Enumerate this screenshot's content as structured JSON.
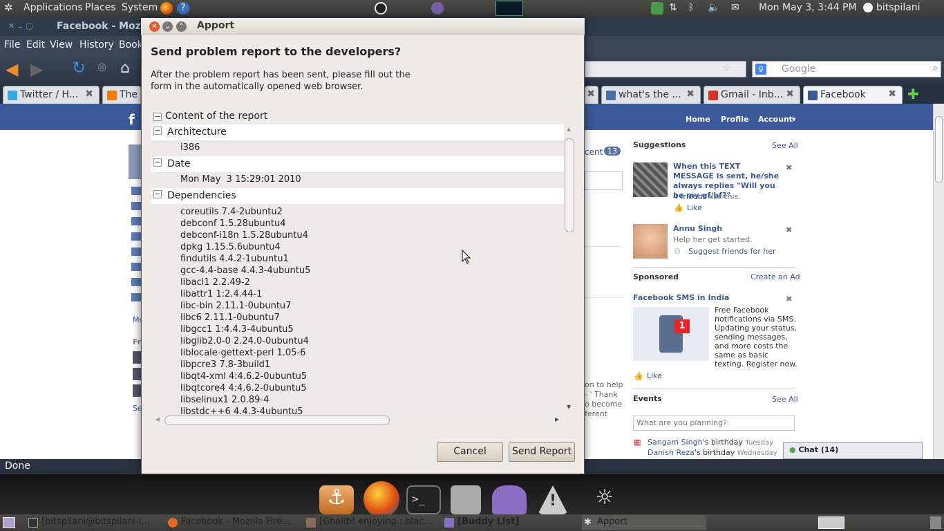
{
  "top_panel": {
    "menus": [
      "Applications",
      "Places",
      "System"
    ],
    "clock": "Mon May  3,  3:44 PM",
    "user": "bitspilani"
  },
  "firefox": {
    "title": "Facebook - Mozi",
    "menu": [
      "File",
      "Edit",
      "View",
      "History",
      "Book"
    ],
    "search_placeholder": "Google",
    "tabs": [
      {
        "label": "Twitter / H...",
        "color": "#33aadd"
      },
      {
        "label": "The S",
        "color": "#f57d00"
      },
      {
        "label": "what's the ...",
        "color": "#4b6ea8"
      },
      {
        "label": "Gmail - Inb...",
        "color": "#d93025"
      },
      {
        "label": "Facebook",
        "color": "#3b5998"
      }
    ],
    "status": "Done"
  },
  "facebook": {
    "nav": [
      "Home",
      "Profile",
      "Account"
    ],
    "recent_label": "cent",
    "recent_count": "13",
    "left_more": "Mo",
    "left_fr": "Fr",
    "left_se": "Se",
    "mid_fragment": [
      "on to help",
      "- ' Thank",
      "o become",
      "ferent"
    ],
    "suggestions": {
      "title": "Suggestions",
      "see_all": "See All",
      "item1_text": "When this TEXT MESSAGE is sent, he/she always replies \"Will you be my gf/bf?\"",
      "item1_friends": "4 friends",
      "item1_like_text": " like this.",
      "item1_like": "Like",
      "item2_name": "Annu Singh",
      "item2_sub": "Help her get started.",
      "item2_action": "Suggest friends for her"
    },
    "sponsored": {
      "title": "Sponsored",
      "create": "Create an Ad",
      "ad_title": "Facebook SMS in India",
      "ad_text": "Free Facebook notifications via SMS. Updating your status, sending messages, and more costs the same as basic texting. Register now.",
      "like": "Like",
      "badge": "1"
    },
    "events": {
      "title": "Events",
      "see_all": "See All",
      "placeholder": "What are you planning?",
      "e1_name": "Sangam Singh",
      "e1_rest": "'s birthday",
      "e1_day": "Tuesday",
      "e2_name": "Danish Reza",
      "e2_rest": "'s birthday",
      "e2_day": "Wednesday"
    },
    "chat": "Chat (14)"
  },
  "dialog": {
    "window_title": "Apport",
    "heading": "Send problem report to the developers?",
    "description_line1": "After the problem report has been sent, please fill out the",
    "description_line2": "form in the automatically opened web browser.",
    "tree_root": "Content of the report",
    "sections": {
      "arch_label": "Architecture",
      "arch_value": "i386",
      "date_label": "Date",
      "date_value": "Mon May  3 15:29:01 2010",
      "deps_label": "Dependencies"
    },
    "dependencies": [
      "coreutils 7.4-2ubuntu2",
      "debconf 1.5.28ubuntu4",
      "debconf-i18n 1.5.28ubuntu4",
      "dpkg 1.15.5.6ubuntu4",
      "findutils 4.4.2-1ubuntu1",
      "gcc-4.4-base 4.4.3-4ubuntu5",
      "libacl1 2.2.49-2",
      "libattr1 1:2.4.44-1",
      "libc-bin 2.11.1-0ubuntu7",
      "libc6 2.11.1-0ubuntu7",
      "libgcc1 1:4.4.3-4ubuntu5",
      "libglib2.0-0 2.24.0-0ubuntu4",
      "liblocale-gettext-perl 1.05-6",
      "libpcre3 7.8-3build1",
      "libqt4-xml 4:4.6.2-0ubuntu5",
      "libqtcore4 4:4.6.2-0ubuntu5",
      "libselinux1 2.0.89-4",
      "libstdc++6 4.4.3-4ubuntu5"
    ],
    "cancel": "Cancel",
    "send": "Send Report"
  },
  "taskbar": [
    "[bitspilani@bitspilani-l...",
    "Facebook - Mozilla Fire...",
    "[Ghalib! enjoying : blac...",
    "[Buddy List]",
    "Apport"
  ]
}
